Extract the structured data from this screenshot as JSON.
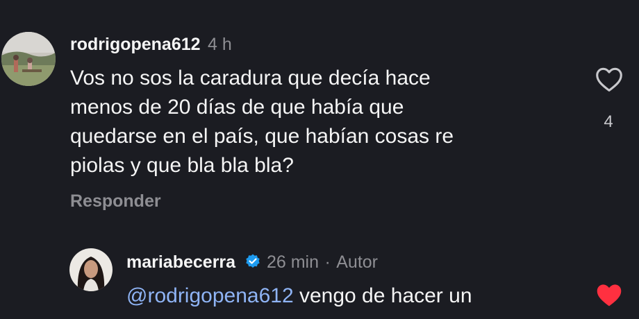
{
  "comments": [
    {
      "username": "rodrigopena612",
      "time": "4 h",
      "text": [
        "Vos no sos la caradura que decía hace",
        "menos de 20 días de que había que",
        "quedarse en el país, que habían cosas re",
        "piolas y que bla bla bla?"
      ],
      "reply_label": "Responder",
      "likes": "4",
      "liked": false,
      "avatar_icon": "landscape-photo-avatar"
    },
    {
      "username": "mariabecerra",
      "verified": true,
      "time": "26 min",
      "separator": "·",
      "author_tag": "Autor",
      "mention": "@rodrigopena612",
      "text_first_line": " vengo de hacer un",
      "liked": true,
      "avatar_icon": "woman-portrait-avatar"
    }
  ],
  "colors": {
    "background": "#1b1c22",
    "secondary_text": "#8e8e93",
    "mention": "#8fb4f5",
    "heart_liked": "#ff3040",
    "verified": "#1d9bf0"
  }
}
